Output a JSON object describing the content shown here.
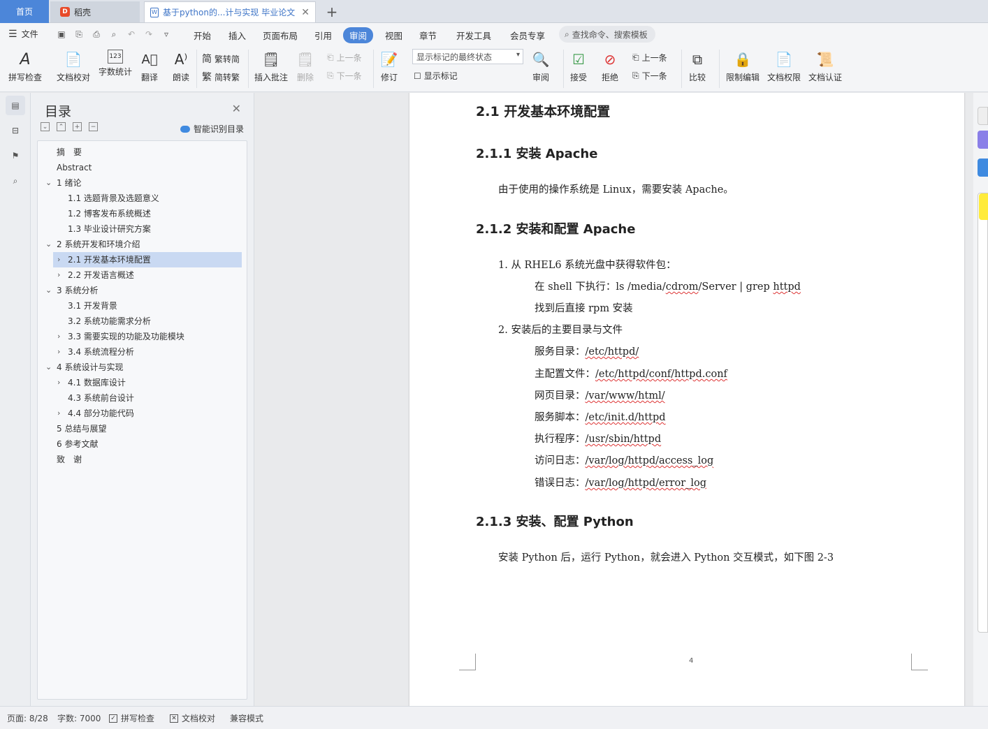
{
  "tabs": {
    "home": "首页",
    "daoke": "稻壳",
    "doc": "基于python的...计与实现 毕业论文",
    "plus": "+"
  },
  "menu": {
    "file": "文件",
    "items": [
      "开始",
      "插入",
      "页面布局",
      "引用",
      "审阅",
      "视图",
      "章节",
      "开发工具",
      "会员专享"
    ],
    "active": "审阅",
    "search": "查找命令、搜索模板"
  },
  "ribbon": {
    "spell": "拼写检查",
    "proof": "文档校对",
    "wordcount": "字数统计",
    "translate": "翻译",
    "read": "朗读",
    "trad": "繁转简",
    "simp": "简转繁",
    "insert_comment": "插入批注",
    "delete": "删除",
    "prev": "上一条",
    "next": "下一条",
    "revise": "修订",
    "markup_state": "显示标记的最终状态",
    "show_markup": "显示标记",
    "review": "审阅",
    "accept": "接受",
    "reject": "拒绝",
    "prev2": "上一条",
    "next2": "下一条",
    "compare": "比较",
    "restrict": "限制编辑",
    "permission": "文档权限",
    "certify": "文档认证"
  },
  "toc": {
    "title": "目录",
    "smart": "智能识别目录",
    "items": [
      {
        "label": "摘　要"
      },
      {
        "label": "Abstract"
      },
      {
        "label": "1 绪论"
      },
      {
        "label": "1.1 选题背景及选题意义"
      },
      {
        "label": "1.2  博客发布系统概述"
      },
      {
        "label": "1.3  毕业设计研究方案"
      },
      {
        "label": "2 系统开发和环境介绍"
      },
      {
        "label": "2.1 开发基本环境配置"
      },
      {
        "label": "2.2  开发语言概述"
      },
      {
        "label": "3 系统分析"
      },
      {
        "label": "3.1 开发背景"
      },
      {
        "label": "3.2 系统功能需求分析"
      },
      {
        "label": "3.3 需要实现的功能及功能模块"
      },
      {
        "label": "3.4 系统流程分析"
      },
      {
        "label": "4 系统设计与实现"
      },
      {
        "label": "4.1 数据库设计"
      },
      {
        "label": "4.3 系统前台设计"
      },
      {
        "label": "4.4 部分功能代码"
      },
      {
        "label": "5 总结与展望"
      },
      {
        "label": "6 参考文献"
      },
      {
        "label": "致　谢"
      }
    ]
  },
  "doc": {
    "h2": "2.1 开发基本环境配置",
    "h3a": "2.1.1 安装 Apache",
    "pa": "由于使用的操作系统是 Linux，需要安装  Apache。",
    "h3b": "2.1.2 安装和配置 Apache",
    "l1": "1.  从 RHEL6 系统光盘中获得软件包：",
    "l1a_pre": "在 shell 下执行：ls /media/",
    "l1a_cd": "cdrom",
    "l1a_mid": "/Server | grep ",
    "l1a_httpd": "httpd",
    "l1b": "找到后直接 rpm 安装",
    "l2": "2.  安装后的主要目录与文件",
    "r1_label": "服务目录：",
    "r1_val": "/etc/httpd/",
    "r2_label": "主配置文件：",
    "r2_val": "/etc/httpd/conf/httpd.conf",
    "r3_label": "网页目录：",
    "r3_val": "/var/www/html/",
    "r4_label": "服务脚本：",
    "r4_val": "/etc/init.d/httpd",
    "r5_label": "执行程序：",
    "r5_val": "/usr/sbin/httpd",
    "r6_label": "访问日志：",
    "r6_val": "/var/log/httpd/access_log",
    "r7_label": "错误日志：",
    "r7_val": "/var/log/httpd/error_log",
    "h3c": "2.1.3 安装、配置 Python",
    "pc": "安装 Python 后，运行 Python，就会进入 Python 交互模式，如下图 2-3",
    "pagenum": "4"
  },
  "status": {
    "page": "页面: 8/28",
    "words": "字数: 7000",
    "spell": "拼写检查",
    "proof": "文档校对",
    "compat": "兼容模式"
  }
}
